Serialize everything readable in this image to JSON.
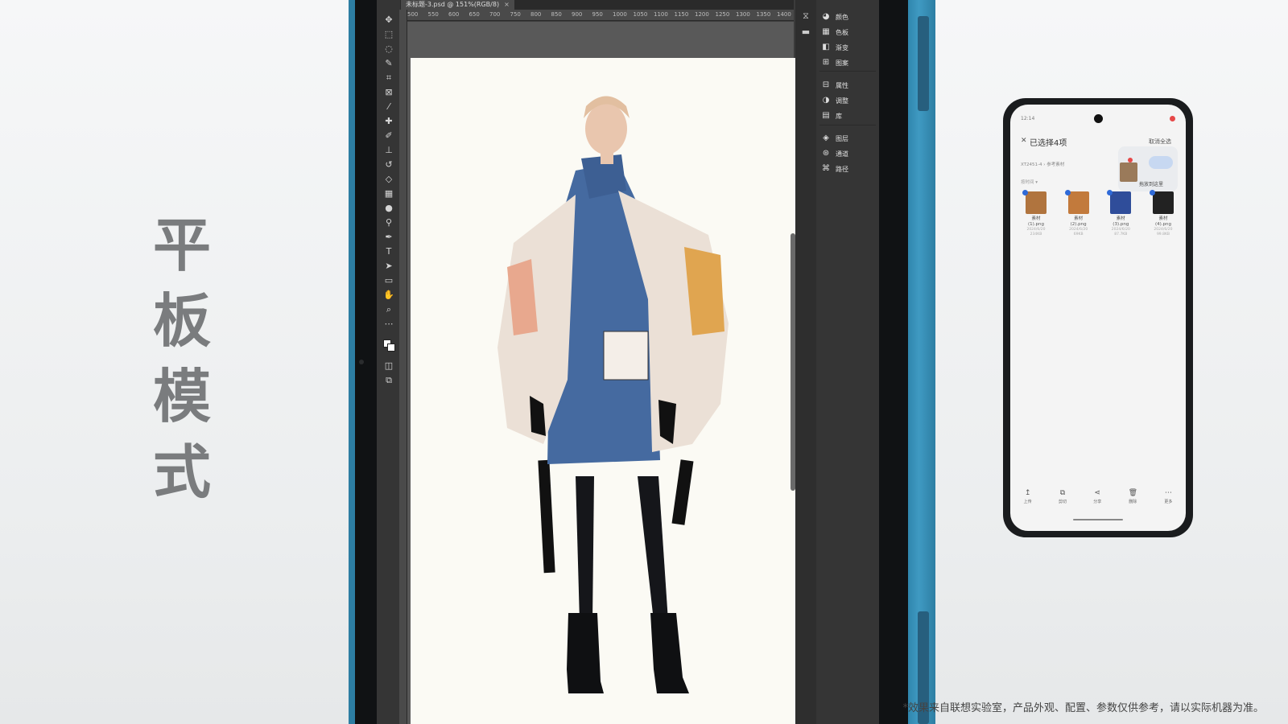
{
  "vertical_title": [
    "平",
    "板",
    "模",
    "式"
  ],
  "photoshop": {
    "tab_title": "未标题-3.psd @ 151%(RGB/8)",
    "tab_close": "×",
    "ruler_ticks": [
      "500",
      "550",
      "600",
      "650",
      "700",
      "750",
      "800",
      "850",
      "900",
      "950",
      "1000",
      "1050",
      "1100",
      "1150",
      "1200",
      "1250",
      "1300",
      "1350",
      "1400"
    ],
    "panels": [
      {
        "icon": "color-wheel-icon",
        "label": "颜色"
      },
      {
        "icon": "swatches-icon",
        "label": "色板"
      },
      {
        "icon": "gradient-icon",
        "label": "渐变"
      },
      {
        "icon": "pattern-icon",
        "label": "图案"
      },
      {
        "icon": "properties-icon",
        "label": "属性"
      },
      {
        "icon": "adjustments-icon",
        "label": "调整"
      },
      {
        "icon": "library-icon",
        "label": "库"
      },
      {
        "icon": "layers-icon",
        "label": "图层"
      },
      {
        "icon": "channels-icon",
        "label": "通道"
      },
      {
        "icon": "paths-icon",
        "label": "路径"
      }
    ]
  },
  "phone": {
    "time": "12:14",
    "title": "已选择4项",
    "cancel_all": "取消全选",
    "crumb": "XT2451-4  ›  参考素材",
    "sort": "按时间 ▾",
    "drop_text": "拖放到这里",
    "files": [
      {
        "name": "素材",
        "file": "(1).png",
        "date": "2024/6/20",
        "size": "234KB",
        "color": "#b0743e"
      },
      {
        "name": "素材",
        "file": "(2).png",
        "date": "2024/6/20",
        "size": "69KB",
        "color": "#c27a3c"
      },
      {
        "name": "素材",
        "file": "(3).png",
        "date": "2024/6/20",
        "size": "87.7KB",
        "color": "#2f4d9a"
      },
      {
        "name": "素材",
        "file": "(4).png",
        "date": "2024/6/20",
        "size": "99.8KB",
        "color": "#222222"
      }
    ],
    "nav": [
      {
        "icon": "↥",
        "label": "上传"
      },
      {
        "icon": "⧉",
        "label": "剪切"
      },
      {
        "icon": "⋖",
        "label": "分享"
      },
      {
        "icon": "🗑",
        "label": "删除"
      },
      {
        "icon": "⋯",
        "label": "更多"
      }
    ]
  },
  "disclaimer": "*效果来自联想实验室，产品外观、配置、参数仅供参考，请以实际机器为准。"
}
